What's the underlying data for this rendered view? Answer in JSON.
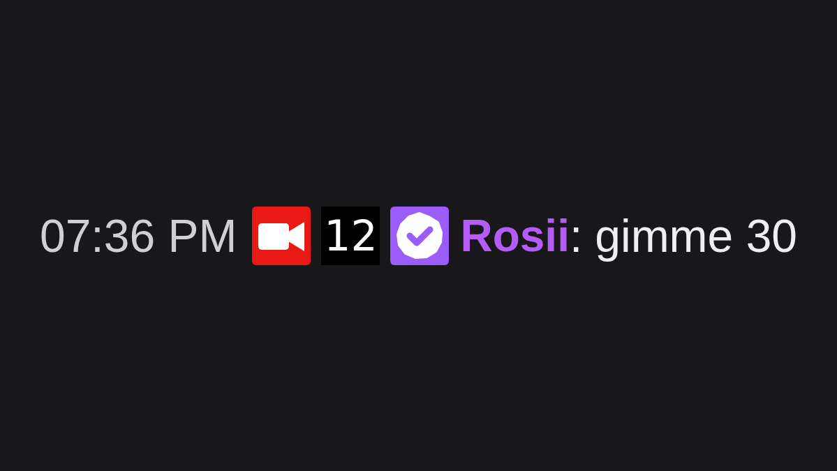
{
  "chat_message": {
    "timestamp": "07:36 PM",
    "badges": [
      {
        "kind": "video"
      },
      {
        "kind": "number",
        "text": "12"
      },
      {
        "kind": "verified"
      }
    ],
    "user": {
      "name": "Rosii",
      "color": "#b45cf5"
    },
    "separator": ":",
    "text": "gimme 30"
  }
}
